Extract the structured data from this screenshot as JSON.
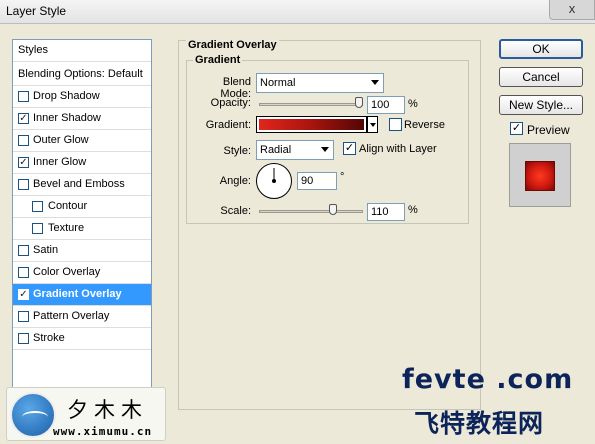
{
  "window": {
    "title": "Layer Style",
    "close_label": "x"
  },
  "styles_panel": {
    "header": "Styles",
    "blending_label": "Blending Options: Default",
    "items": [
      {
        "label": "Drop Shadow",
        "checked": false,
        "indent": false,
        "selected": false
      },
      {
        "label": "Inner Shadow",
        "checked": true,
        "indent": false,
        "selected": false
      },
      {
        "label": "Outer Glow",
        "checked": false,
        "indent": false,
        "selected": false
      },
      {
        "label": "Inner Glow",
        "checked": true,
        "indent": false,
        "selected": false
      },
      {
        "label": "Bevel and Emboss",
        "checked": false,
        "indent": false,
        "selected": false
      },
      {
        "label": "Contour",
        "checked": false,
        "indent": true,
        "selected": false
      },
      {
        "label": "Texture",
        "checked": false,
        "indent": true,
        "selected": false
      },
      {
        "label": "Satin",
        "checked": false,
        "indent": false,
        "selected": false
      },
      {
        "label": "Color Overlay",
        "checked": false,
        "indent": false,
        "selected": false
      },
      {
        "label": "Gradient Overlay",
        "checked": true,
        "indent": false,
        "selected": true
      },
      {
        "label": "Pattern Overlay",
        "checked": false,
        "indent": false,
        "selected": false
      },
      {
        "label": "Stroke",
        "checked": false,
        "indent": false,
        "selected": false
      }
    ]
  },
  "gradient_overlay": {
    "group_title": "Gradient Overlay",
    "subgroup_title": "Gradient",
    "blend_mode": {
      "label": "Blend Mode:",
      "value": "Normal"
    },
    "opacity": {
      "label": "Opacity:",
      "value": "100",
      "unit": "%",
      "level": 1.0
    },
    "gradient": {
      "label": "Gradient:",
      "colors": [
        "#e1261c",
        "#a8140e",
        "#520706"
      ]
    },
    "reverse": {
      "label": "Reverse",
      "checked": false
    },
    "style": {
      "label": "Style:",
      "value": "Radial"
    },
    "align_with_layer": {
      "label": "Align with Layer",
      "checked": true
    },
    "angle": {
      "label": "Angle:",
      "value": "90",
      "unit": "°"
    },
    "scale": {
      "label": "Scale:",
      "value": "110",
      "unit": "%",
      "level": 0.73
    }
  },
  "buttons": {
    "ok": "OK",
    "cancel": "Cancel",
    "new_style": "New Style...",
    "preview_label": "Preview",
    "preview_checked": true
  },
  "watermarks": {
    "left_cn": "夕木木",
    "left_url": "www.ximumu.cn",
    "right_brand": "fevte .com",
    "right_cn": "飞特教程网"
  }
}
